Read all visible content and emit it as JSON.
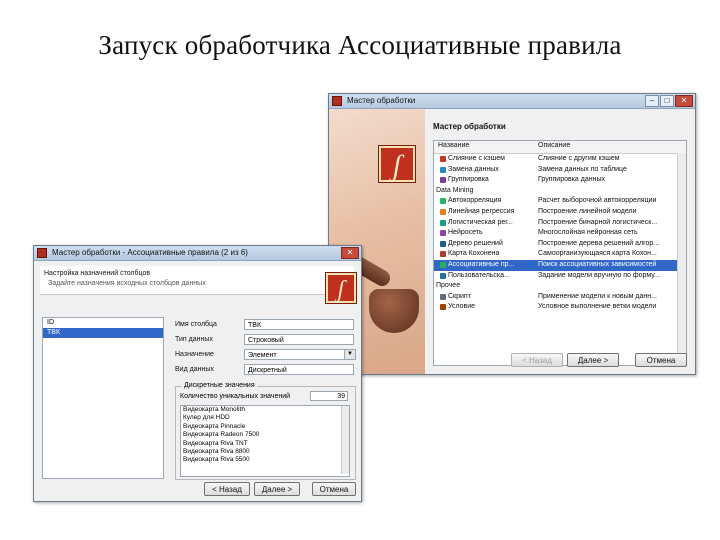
{
  "slide": {
    "title": "Запуск обработчика Ассоциативные правила"
  },
  "wizard_main": {
    "window_title": "Мастер обработки",
    "heading": "Мастер обработки",
    "col_name": "Название",
    "col_desc": "Описание",
    "rows": [
      {
        "name": "Слияние с кэшем",
        "desc": "Слияние с другим кэшем",
        "type": "item",
        "icon": "merge-icon"
      },
      {
        "name": "Замена данных",
        "desc": "Замена данных по таблице",
        "type": "item",
        "icon": "replace-icon"
      },
      {
        "name": "Группировка",
        "desc": "Группировка данных",
        "type": "item",
        "icon": "group-icon"
      },
      {
        "name": "Data Mining",
        "desc": "",
        "type": "group",
        "icon": "folder-icon"
      },
      {
        "name": "Автокорреляция",
        "desc": "Расчет выборочной автокорреляции",
        "type": "item",
        "icon": "autocorr-icon"
      },
      {
        "name": "Линейная регрессия",
        "desc": "Построение линейной модели",
        "type": "item",
        "icon": "regression-icon"
      },
      {
        "name": "Логистическая рег...",
        "desc": "Построение бинарной логистическ...",
        "type": "item",
        "icon": "logistic-icon"
      },
      {
        "name": "Нейросеть",
        "desc": "Многослойная нейронная сеть",
        "type": "item",
        "icon": "neural-icon"
      },
      {
        "name": "Дерево решений",
        "desc": "Построение дерева решений алгор...",
        "type": "item",
        "icon": "tree-icon"
      },
      {
        "name": "Карта Кохонена",
        "desc": "Самоорганизующаяся карта Кохон...",
        "type": "item",
        "icon": "kohonen-icon"
      },
      {
        "name": "Ассоциативные пр...",
        "desc": "Поиск ассоциативных зависимостей",
        "type": "item",
        "icon": "assoc-icon",
        "selected": true
      },
      {
        "name": "Пользовательска...",
        "desc": "Задание модели вручную по форму...",
        "type": "item",
        "icon": "custom-icon"
      },
      {
        "name": "Прочее",
        "desc": "",
        "type": "group",
        "icon": "folder-icon"
      },
      {
        "name": "Скрипт",
        "desc": "Применение модели к новым данн...",
        "type": "item",
        "icon": "script-icon"
      },
      {
        "name": "Условие",
        "desc": "Условное выполнение ветки модели",
        "type": "item",
        "icon": "condition-icon"
      }
    ],
    "btn_back": "< Назад",
    "btn_next": "Далее >",
    "btn_cancel": "Отмена"
  },
  "wizard_assoc": {
    "window_title": "Мастер обработки - Ассоциативные правила (2 из 6)",
    "heading": "Настройка назначений столбцов",
    "subheading": "Задайте назначения исходных столбцов данных",
    "list_items": [
      "ID",
      "ТВК"
    ],
    "selected_item_index": 1,
    "fields": [
      {
        "label": "Имя столбца",
        "value": "ТВК"
      },
      {
        "label": "Тип данных",
        "value": "Строковый"
      },
      {
        "label": "Назначение",
        "value": "Элемент",
        "dropdown": true
      },
      {
        "label": "Вид данных",
        "value": "Дискретный"
      }
    ],
    "group_title": "Дискретные значения",
    "count_label": "Количество уникальных значений",
    "count_value": "39",
    "values": [
      "Видеокарта Monolith",
      "Кулер для HDD",
      "Видеокарта Pinnacle",
      "Видеокарта Radeon 7500",
      "Видеокарта Riva TNT",
      "Видеокарта Riva 8800",
      "Видеокарта Riva 5500"
    ],
    "btn_back": "< Назад",
    "btn_next": "Далее >",
    "btn_cancel": "Отмена"
  },
  "colors": {
    "selection": "#3168c8",
    "logo": "#c0301f",
    "titlebar": "#c2d6ea"
  }
}
